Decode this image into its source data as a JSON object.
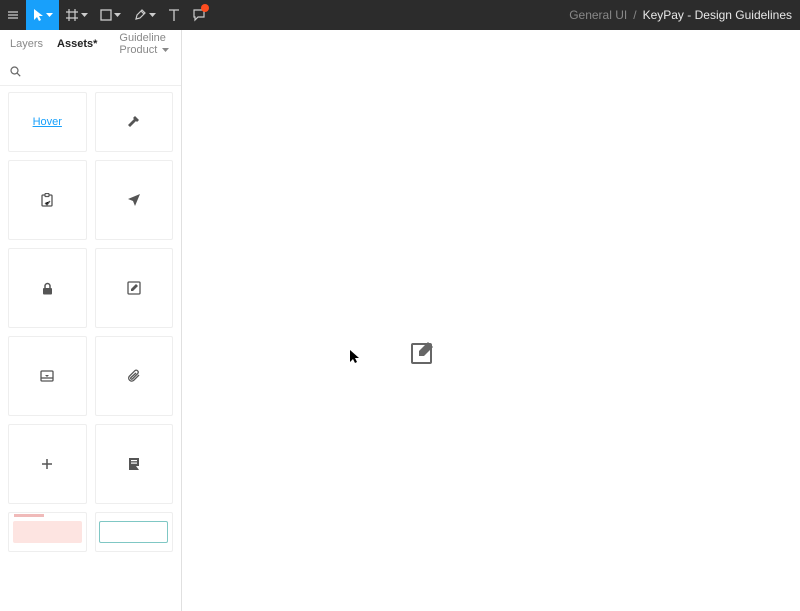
{
  "toolbar": {
    "breadcrumb_parent": "General UI",
    "breadcrumb_sep": "/",
    "breadcrumb_current": "KeyPay - Design Guidelines"
  },
  "tabs": {
    "layers": "Layers",
    "assets": "Assets",
    "assets_dirty": "*",
    "page": "Guideline Product"
  },
  "search": {
    "placeholder": ""
  },
  "assets": {
    "hover_label": "Hover"
  }
}
